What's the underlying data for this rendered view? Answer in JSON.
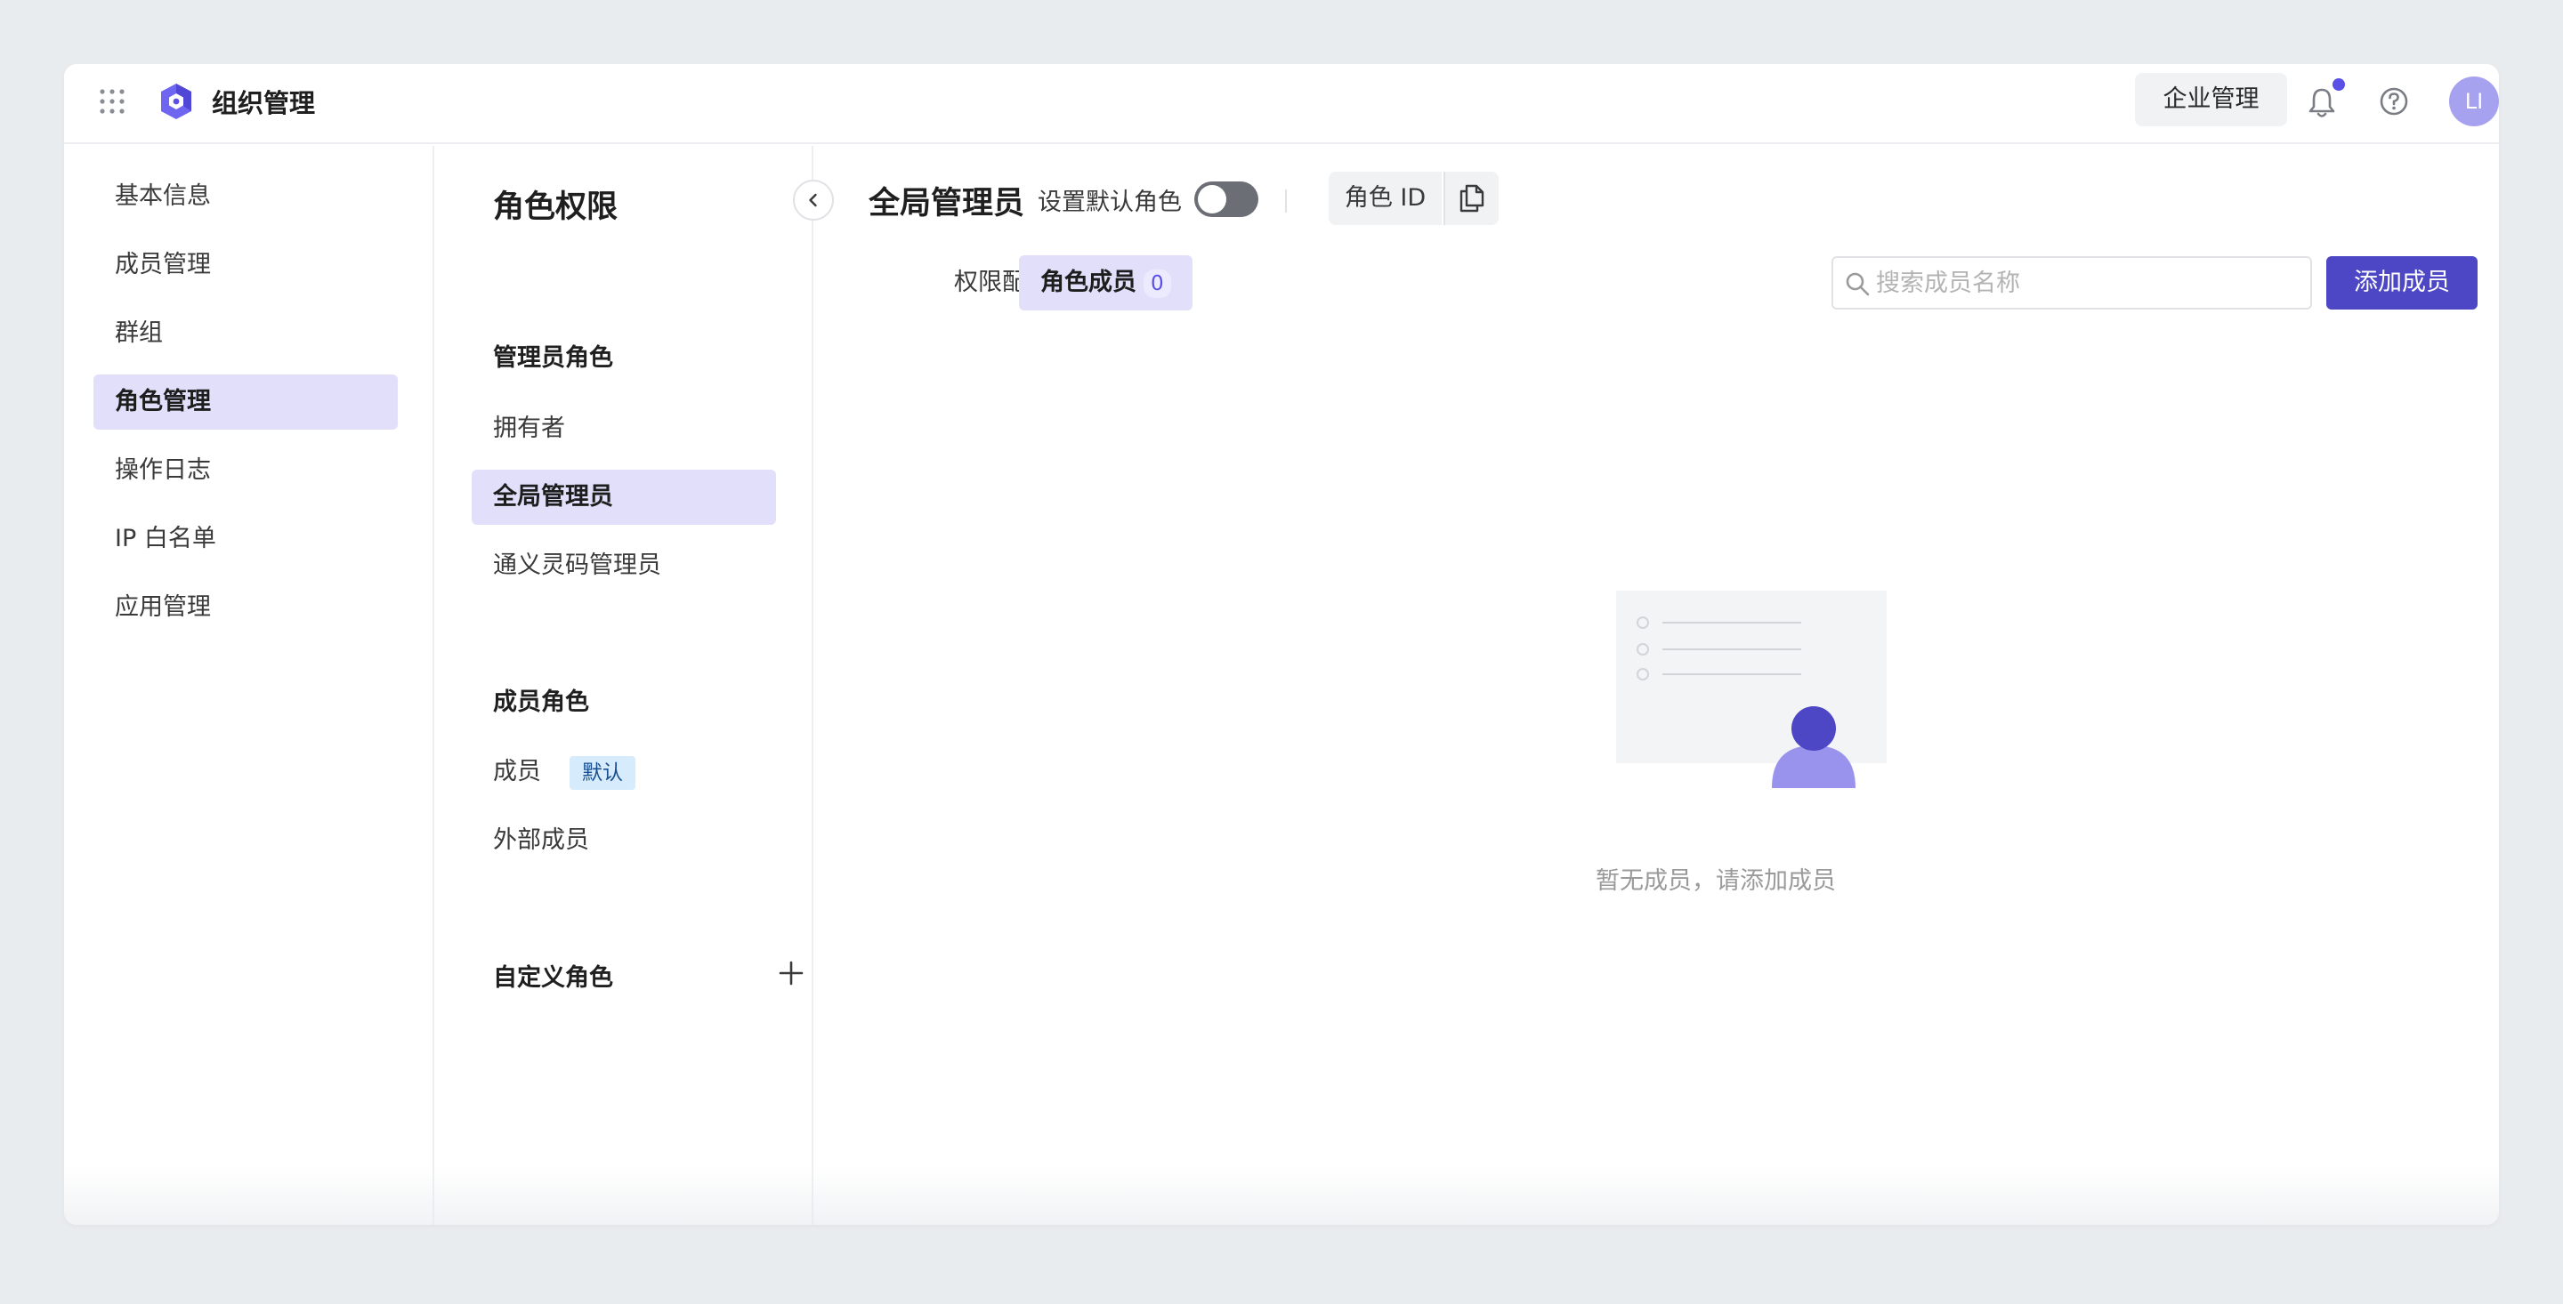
{
  "header": {
    "app_title": "组织管理",
    "enterprise_button": "企业管理",
    "avatar_initials": "LI",
    "accent_color": "#5b50e6"
  },
  "left_nav": {
    "items": [
      {
        "label": "基本信息",
        "active": false
      },
      {
        "label": "成员管理",
        "active": false
      },
      {
        "label": "群组",
        "active": false
      },
      {
        "label": "角色管理",
        "active": true
      },
      {
        "label": "操作日志",
        "active": false
      },
      {
        "label": "IP 白名单",
        "active": false
      },
      {
        "label": "应用管理",
        "active": false
      }
    ]
  },
  "role_panel": {
    "title": "角色权限",
    "admin_section": "管理员角色",
    "admin_roles": [
      "拥有者",
      "全局管理员",
      "通义灵码管理员"
    ],
    "member_section": "成员角色",
    "member_roles": [
      "成员",
      "外部成员"
    ],
    "default_badge": "默认",
    "custom_section": "自定义角色"
  },
  "main": {
    "role_title": "全局管理员",
    "default_role_label": "设置默认角色",
    "default_role_toggle": false,
    "role_id_label": "角色 ID",
    "tabs": [
      {
        "label": "权限配置",
        "active": false
      },
      {
        "label": "角色成员",
        "active": true,
        "count": "0"
      }
    ],
    "search_placeholder": "搜索成员名称",
    "add_member_button": "添加成员",
    "empty_text": "暂无成员，请添加成员"
  }
}
